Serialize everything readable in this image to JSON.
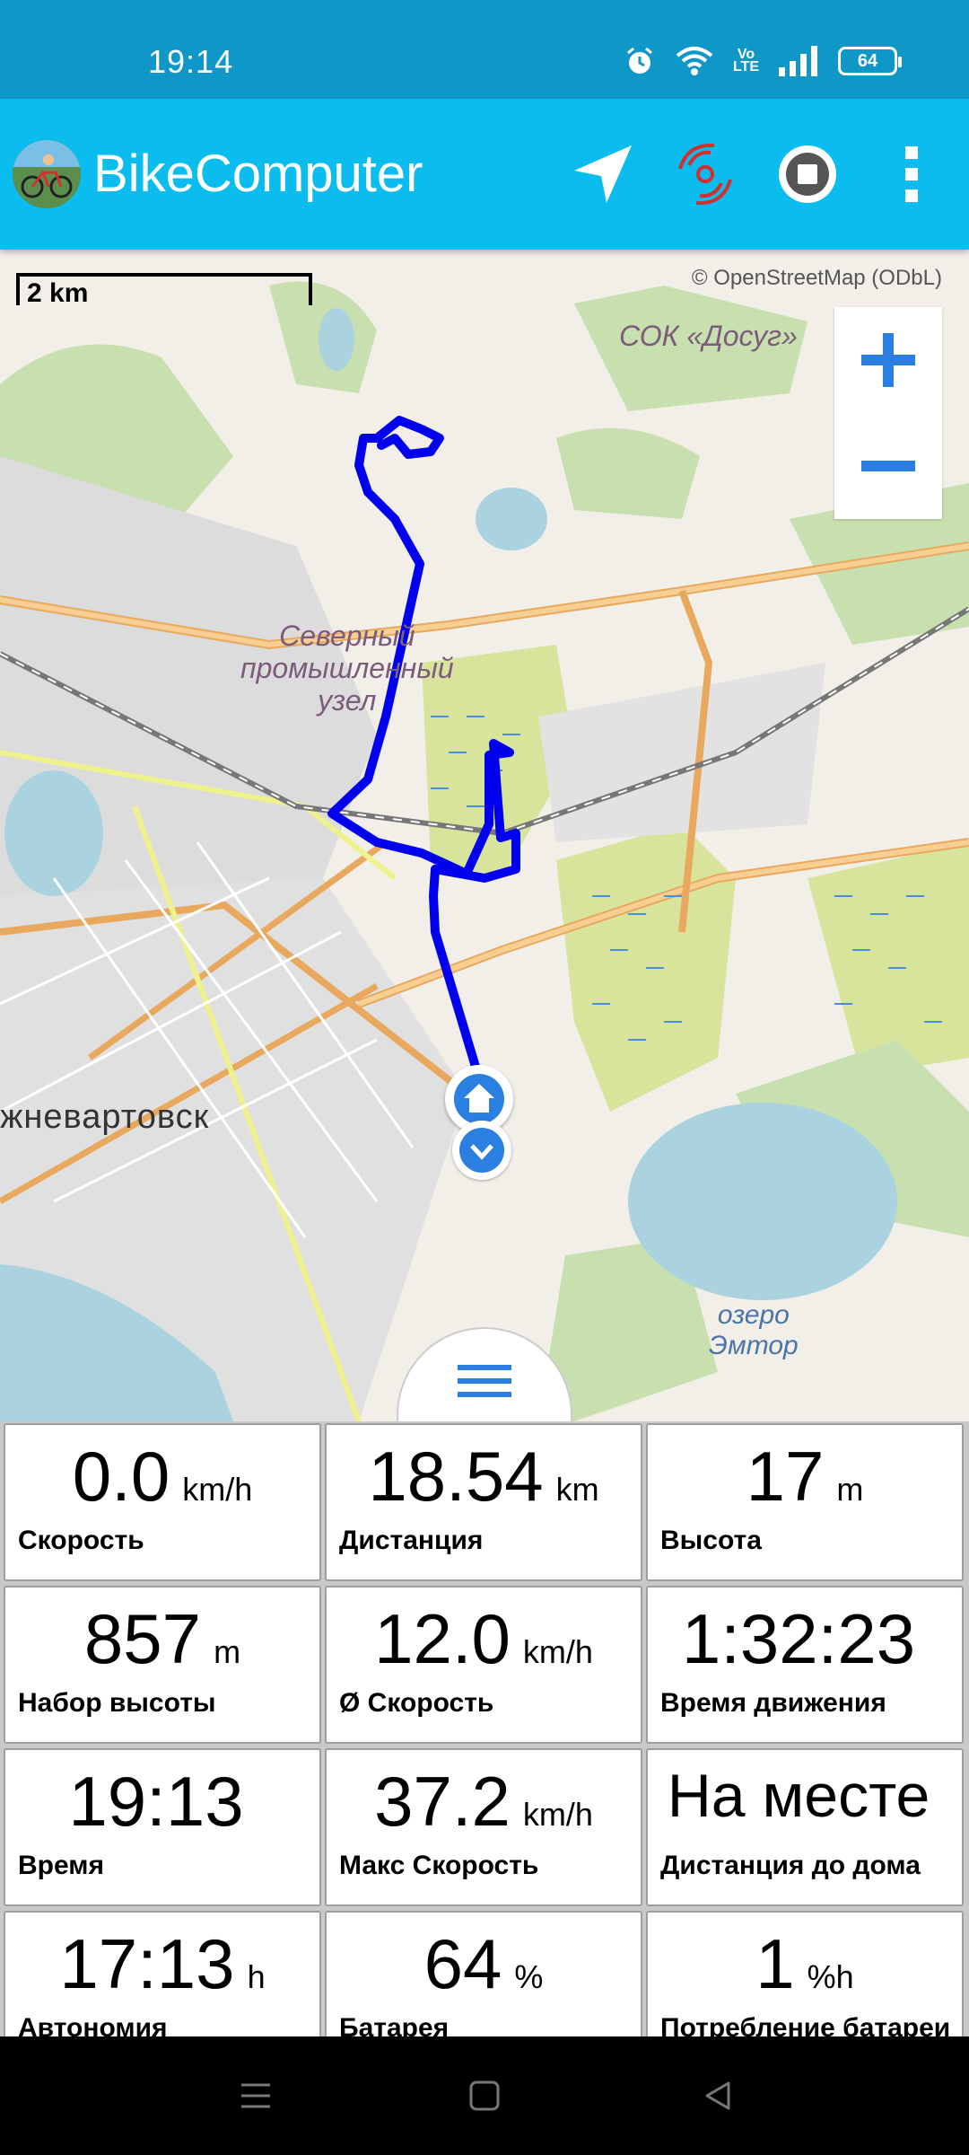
{
  "status_bar": {
    "time": "19:14",
    "volte": "Vo\nLTE",
    "battery": "64",
    "icons": [
      "alarm-icon",
      "wifi-icon",
      "volte-icon",
      "signal-icon",
      "battery-icon"
    ]
  },
  "app_bar": {
    "title": "BikeComputer",
    "actions": [
      "navigation-arrow-icon",
      "sensors-icon",
      "stop-icon",
      "more-vert-icon"
    ],
    "colors": {
      "bar": "#0bbcef",
      "status": "#0f97c8"
    }
  },
  "map": {
    "scale": "2 km",
    "attribution": "© OpenStreetMap (ODbL)",
    "labels": {
      "sok": "СОК «Досуг»",
      "industrial": "Северный\nпромышленный\nузел",
      "city": "жневартовск",
      "lake": "озеро\nЭмтор"
    },
    "track_color": "#0000ee"
  },
  "stats": [
    {
      "value": "0.0",
      "unit": "km/h",
      "label": "Скорость"
    },
    {
      "value": "18.54",
      "unit": "km",
      "label": "Дистанция"
    },
    {
      "value": "17",
      "unit": "m",
      "label": "Высота"
    },
    {
      "value": "857",
      "unit": "m",
      "label": "Набор высоты"
    },
    {
      "value": "12.0",
      "unit": "km/h",
      "label": "Ø Скорость"
    },
    {
      "value": "1:32:23",
      "unit": "",
      "label": "Время движения"
    },
    {
      "value": "19:13",
      "unit": "",
      "label": "Время"
    },
    {
      "value": "37.2",
      "unit": "km/h",
      "label": "Макс Скорость"
    },
    {
      "value": "На месте",
      "unit": "",
      "label": "Дистанция до дома"
    },
    {
      "value": "17:13",
      "unit": "h",
      "label": "Автономия"
    },
    {
      "value": "64",
      "unit": "%",
      "label": "Батарея"
    },
    {
      "value": "1",
      "unit": "%h",
      "label": "Потребление батареи"
    }
  ]
}
